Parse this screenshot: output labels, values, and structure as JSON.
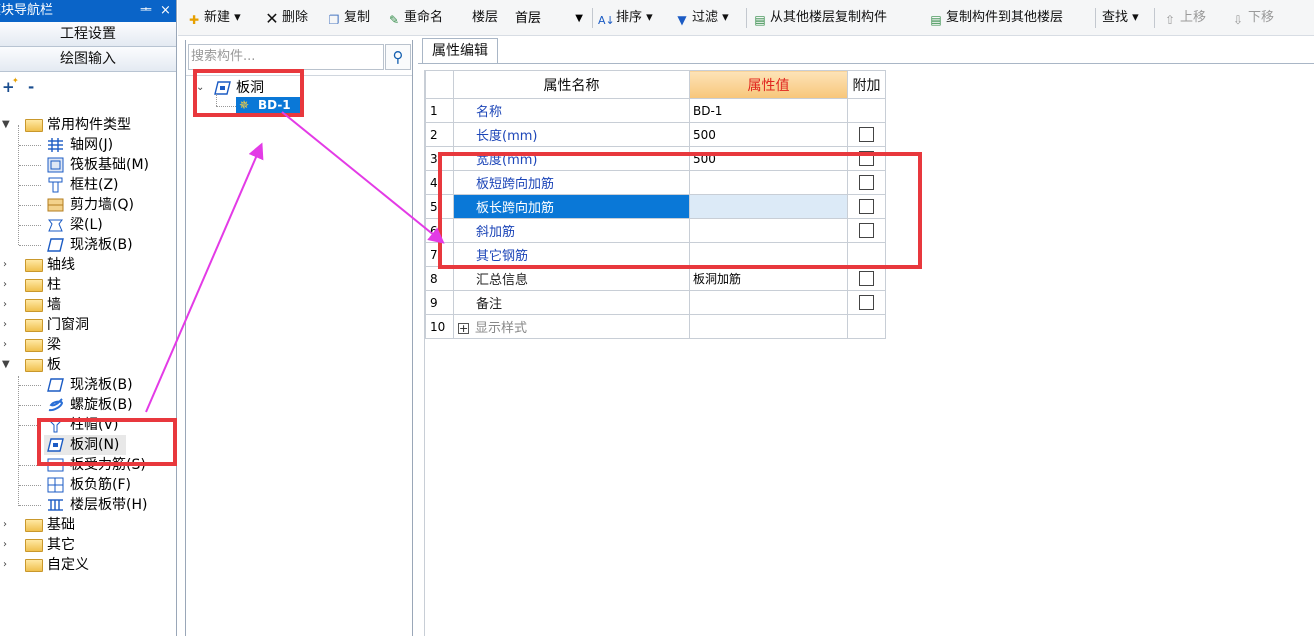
{
  "nav": {
    "title": "模块导航栏",
    "pin_glyph": "ᆂ",
    "close_glyph": "×",
    "btn_project": "工程设置",
    "btn_draw": "绘图输入",
    "expand_all": "+",
    "collapse_all": "-",
    "tree": {
      "common_types": "常用构件类型",
      "common_children": [
        "轴网(J)",
        "筏板基础(M)",
        "框柱(Z)",
        "剪力墙(Q)",
        "梁(L)",
        "现浇板(B)"
      ],
      "groups": [
        "轴线",
        "柱",
        "墙",
        "门窗洞",
        "梁"
      ],
      "board": "板",
      "board_children": [
        "现浇板(B)",
        "螺旋板(B)",
        "柱帽(V)",
        "板洞(N)",
        "板受力筋(S)",
        "板负筋(F)",
        "楼层板带(H)"
      ],
      "tail_groups": [
        "基础",
        "其它",
        "自定义"
      ]
    }
  },
  "toolbar": {
    "new": "新建",
    "delete": "删除",
    "copy": "复制",
    "rename": "重命名",
    "floor_label": "楼层",
    "floor_value": "首层",
    "sort": "排序",
    "filter": "过滤",
    "copy_from": "从其他楼层复制构件",
    "copy_to": "复制构件到其他楼层",
    "find": "查找",
    "move_up": "上移",
    "move_down": "下移"
  },
  "middle": {
    "search_placeholder": "搜索构件...",
    "root": "板洞",
    "child": "BD-1"
  },
  "props": {
    "tab": "属性编辑",
    "headers": {
      "name": "属性名称",
      "value": "属性值",
      "extra": "附加"
    },
    "rows": [
      {
        "no": "1",
        "name": "名称",
        "value": "BD-1",
        "checkbox": false
      },
      {
        "no": "2",
        "name": "长度(mm)",
        "value": "500",
        "checkbox": true
      },
      {
        "no": "3",
        "name": "宽度(mm)",
        "value": "500",
        "checkbox": true
      },
      {
        "no": "4",
        "name": "板短跨向加筋",
        "value": "",
        "checkbox": true
      },
      {
        "no": "5",
        "name": "板长跨向加筋",
        "value": "",
        "checkbox": true
      },
      {
        "no": "6",
        "name": "斜加筋",
        "value": "",
        "checkbox": true
      },
      {
        "no": "7",
        "name": "其它钢筋",
        "value": "",
        "checkbox": false
      },
      {
        "no": "8",
        "name": "汇总信息",
        "value": "板洞加筋",
        "checkbox": true
      },
      {
        "no": "9",
        "name": "备注",
        "value": "",
        "checkbox": true
      },
      {
        "no": "10",
        "name": "显示样式",
        "value": "",
        "checkbox": false
      }
    ]
  },
  "colors": {
    "annotation_red": "#e8383d",
    "arrow_magenta": "#e33be6",
    "selection_blue": "#0a78d7",
    "nav_title_blue": "#0a64c8"
  }
}
